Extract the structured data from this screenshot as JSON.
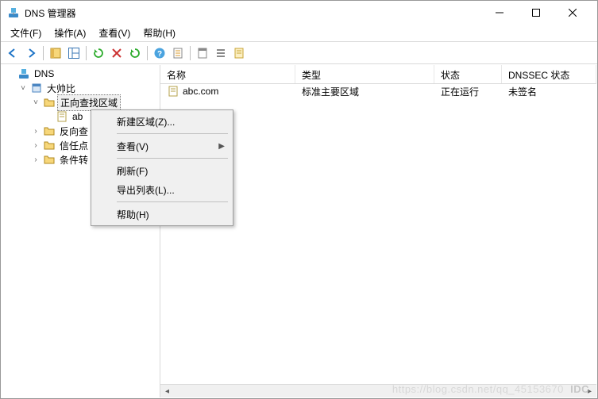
{
  "window": {
    "title": "DNS 管理器"
  },
  "menubar": {
    "file": "文件(F)",
    "action": "操作(A)",
    "view": "查看(V)",
    "help": "帮助(H)"
  },
  "tree": {
    "root": "DNS",
    "server": "大帅比",
    "forward": "正向查找区域",
    "zone_abc": "abc.com",
    "reverse_fragment": "反向查",
    "trust_fragment": "信任点",
    "conditional_fragment": "条件转"
  },
  "list": {
    "headers": {
      "name": "名称",
      "type": "类型",
      "status": "状态",
      "dnssec": "DNSSEC 状态"
    },
    "rows": [
      {
        "name": "abc.com",
        "type": "标准主要区域",
        "status": "正在运行",
        "dnssec": "未签名"
      }
    ]
  },
  "context_menu": {
    "new_zone": "新建区域(Z)...",
    "view": "查看(V)",
    "refresh": "刷新(F)",
    "export_list": "导出列表(L)...",
    "help": "帮助(H)"
  },
  "watermark": "https://blog.csdn.net/qq_45153670",
  "watermark2": "IDC"
}
